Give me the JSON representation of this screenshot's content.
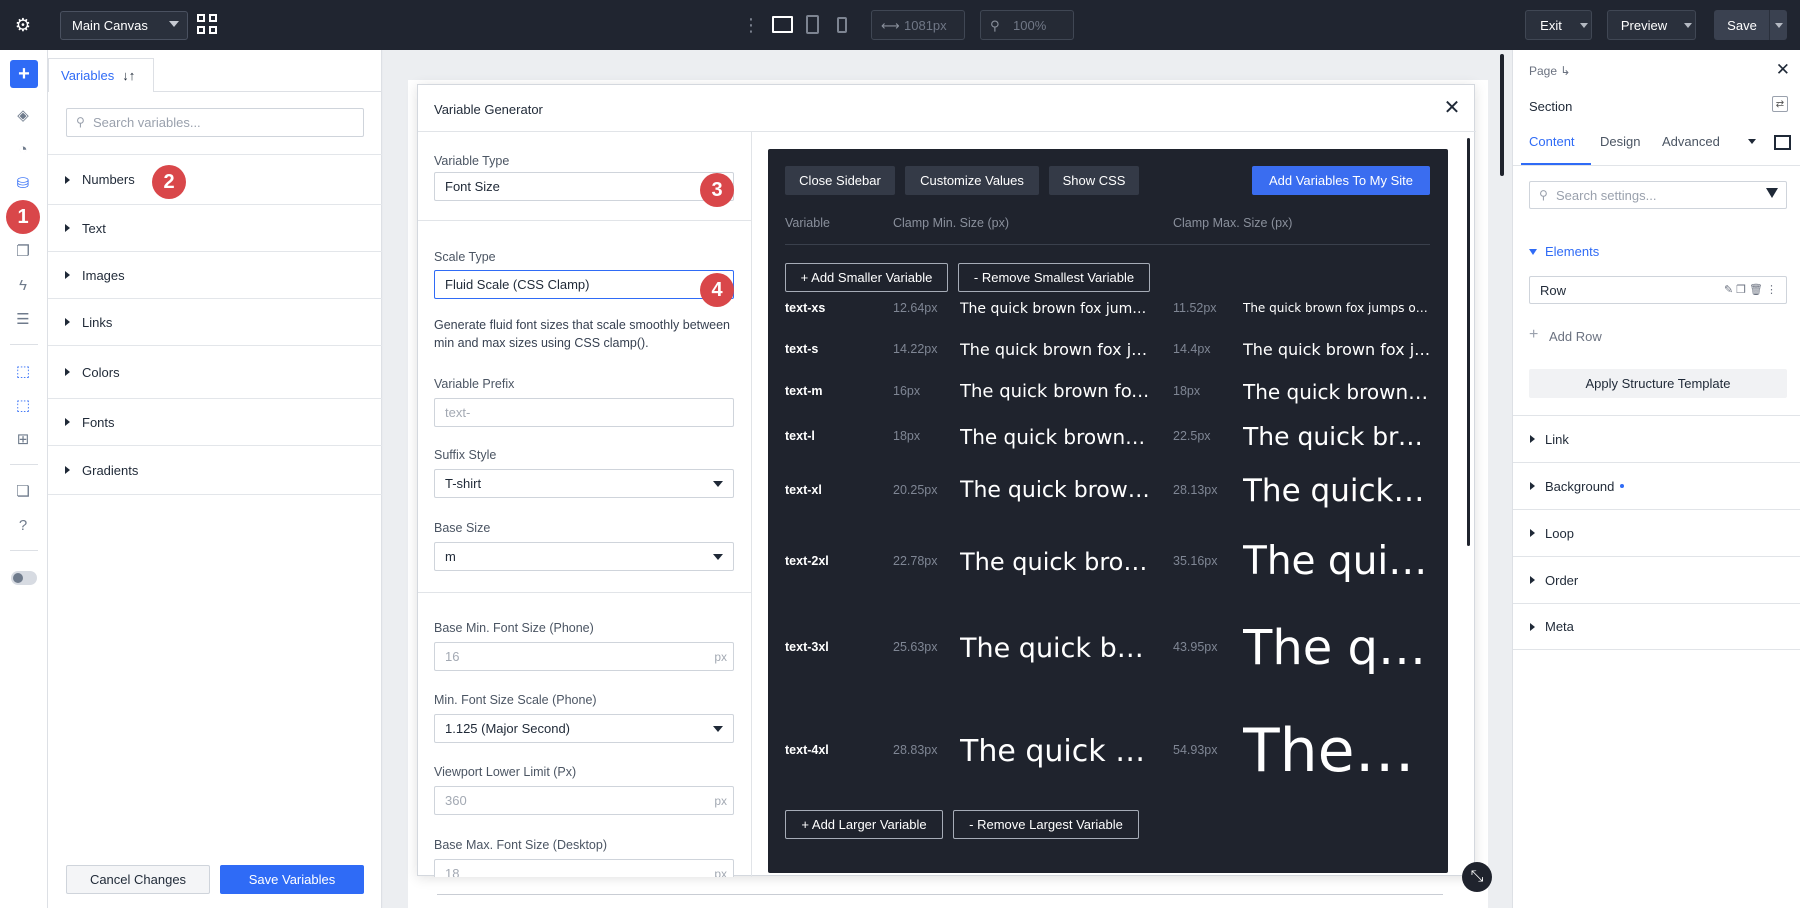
{
  "topbar": {
    "canvas_select": "Main Canvas",
    "width_value": "1081px",
    "zoom_value": "100%",
    "exit_label": "Exit",
    "preview_label": "Preview",
    "save_label": "Save",
    "icons": [
      "gear-icon",
      "grid-icon",
      "desktop-icon",
      "tablet-icon",
      "phone-icon"
    ]
  },
  "rail": {
    "icons": [
      "add-icon",
      "layers-icon",
      "shapes-icon",
      "database-icon",
      "pages-icon",
      "lightning-icon",
      "sliders-icon",
      "cursor-select-icon",
      "cursor-select-alt-icon",
      "template-icon",
      "stack-icon",
      "help-icon",
      "toggle-icon"
    ]
  },
  "left_panel": {
    "tab_label": "Variables",
    "search_placeholder": "Search variables...",
    "groups": [
      "Numbers",
      "Text",
      "Images",
      "Links",
      "Colors",
      "Fonts",
      "Gradients"
    ],
    "cancel_label": "Cancel Changes",
    "save_label": "Save Variables"
  },
  "markers": [
    "1",
    "2",
    "3",
    "4"
  ],
  "modal": {
    "title": "Variable Generator",
    "form": {
      "variable_type_label": "Variable Type",
      "variable_type_value": "Font Size",
      "scale_type_label": "Scale Type",
      "scale_type_value": "Fluid Scale (CSS Clamp)",
      "scale_help": "Generate fluid font sizes that scale smoothly between min and max sizes using CSS clamp().",
      "prefix_label": "Variable Prefix",
      "prefix_placeholder": "text-",
      "suffix_label": "Suffix Style",
      "suffix_value": "T-shirt",
      "base_size_label": "Base Size",
      "base_size_value": "m",
      "base_min_label": "Base Min. Font Size (Phone)",
      "base_min_placeholder": "16",
      "min_scale_label": "Min. Font Size Scale (Phone)",
      "min_scale_value": "1.125 (Major Second)",
      "vp_lower_label": "Viewport Lower Limit (Px)",
      "vp_lower_placeholder": "360",
      "base_max_label": "Base Max. Font Size (Desktop)",
      "base_max_placeholder": "18",
      "unit": "px"
    },
    "preview": {
      "close_sidebar": "Close Sidebar",
      "customize_values": "Customize Values",
      "show_css": "Show CSS",
      "add_to_site": "Add Variables To My Site",
      "col_variable": "Variable",
      "col_min": "Clamp Min. Size (px)",
      "col_max": "Clamp Max. Size (px)",
      "add_smaller": "+ Add Smaller Variable",
      "remove_smallest": "- Remove Smallest Variable",
      "add_larger": "+ Add Larger Variable",
      "remove_largest": "- Remove Largest Variable",
      "sample_text": "The quick brown fox jumps over the lazy dog",
      "rows": [
        {
          "name": "text-xs",
          "min": "12.64px",
          "max": "11.52px"
        },
        {
          "name": "text-s",
          "min": "14.22px",
          "max": "14.4px"
        },
        {
          "name": "text-m",
          "min": "16px",
          "max": "18px"
        },
        {
          "name": "text-l",
          "min": "18px",
          "max": "22.5px"
        },
        {
          "name": "text-xl",
          "min": "20.25px",
          "max": "28.13px"
        },
        {
          "name": "text-2xl",
          "min": "22.78px",
          "max": "35.16px"
        },
        {
          "name": "text-3xl",
          "min": "25.63px",
          "max": "43.95px"
        },
        {
          "name": "text-4xl",
          "min": "28.83px",
          "max": "54.93px"
        }
      ]
    }
  },
  "right_panel": {
    "page_label": "Page",
    "section_label": "Section",
    "tabs": [
      "Content",
      "Design",
      "Advanced"
    ],
    "search_placeholder": "Search settings...",
    "elements_label": "Elements",
    "row_label": "Row",
    "add_row_label": "Add Row",
    "apply_template_label": "Apply Structure Template",
    "accordions": [
      "Link",
      "Background",
      "Loop",
      "Order",
      "Meta"
    ],
    "accent_color": "#2f6bf6"
  }
}
